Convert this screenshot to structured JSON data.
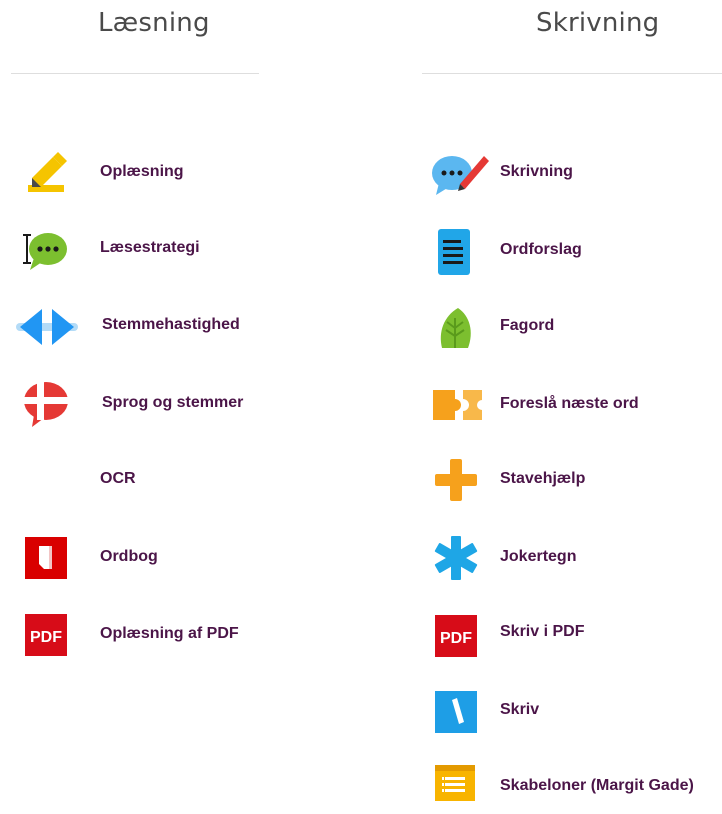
{
  "left": {
    "title": "Læsning",
    "items": [
      {
        "label": "Oplæsning",
        "icon": "highlighter-icon"
      },
      {
        "label": "Læsestrategi",
        "icon": "speech-bubble-cursor-icon"
      },
      {
        "label": "Stemmehastighed",
        "icon": "speed-arrows-icon"
      },
      {
        "label": "Sprog og stemmer",
        "icon": "danish-flag-bubble-icon"
      },
      {
        "label": "OCR",
        "icon": ""
      },
      {
        "label": "Ordbog",
        "icon": "book-icon"
      },
      {
        "label": "Oplæsning af PDF",
        "icon": "pdf-icon",
        "icon_text": "PDF"
      }
    ]
  },
  "right": {
    "title": "Skrivning",
    "items": [
      {
        "label": "Skrivning",
        "icon": "speech-bubble-pen-icon"
      },
      {
        "label": "Ordforslag",
        "icon": "text-lines-icon"
      },
      {
        "label": "Fagord",
        "icon": "leaf-icon"
      },
      {
        "label": "Foreslå næste ord",
        "icon": "puzzle-icon"
      },
      {
        "label": "Stavehjælp",
        "icon": "plus-icon"
      },
      {
        "label": "Jokertegn",
        "icon": "asterisk-icon"
      },
      {
        "label": "Skriv i PDF",
        "icon": "pdf-icon",
        "icon_text": "PDF"
      },
      {
        "label": "Skriv",
        "icon": "pen-square-icon"
      },
      {
        "label": "Skabeloner (Margit Gade)",
        "icon": "template-icon"
      }
    ]
  },
  "colors": {
    "label": "#4b1548",
    "header": "#4a4a4a",
    "divider": "#dedede",
    "highlighter": "#f5c400",
    "bubble_green": "#7cbf2f",
    "speed_blue": "#2196f3",
    "flag_red": "#e53935",
    "book_red": "#d90000",
    "pdf_red": "#d70c18",
    "bubble_blue": "#5bb7f0",
    "pen_red": "#e53935",
    "lines_blue": "#21a6e8",
    "leaf_green": "#7cbf2f",
    "puzzle_orange": "#f6a11c",
    "plus_orange": "#f6a11c",
    "asterisk_blue": "#1ea6e6",
    "skriv_blue": "#1e9ee6",
    "template_yellow": "#f8b400"
  }
}
